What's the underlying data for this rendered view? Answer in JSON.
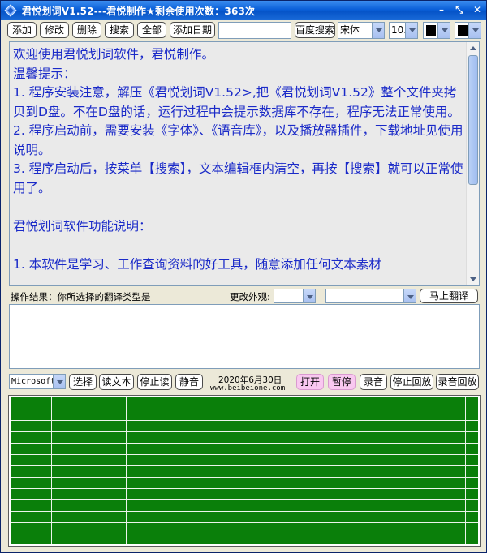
{
  "window": {
    "title": "君悦划词V1.52---君悦制作★剩余使用次数：363次"
  },
  "toolbar": {
    "add": "添加",
    "edit": "修改",
    "delete": "删除",
    "search": "搜索",
    "all": "全部",
    "add_date": "添加日期",
    "search_input_value": "",
    "baidu_search": "百度搜索",
    "font_value": "宋体",
    "font_size_value": "10.",
    "text_color": "#000000",
    "bg_color": "#000000"
  },
  "main_text": {
    "lines": [
      "欢迎使用君悦划词软件，君悦制作。",
      "温馨提示：",
      "1. 程序安装注意，解压《君悦划词V1.52>,把《君悦划词V1.52》整个文件夹拷贝到D盘。不在D盘的话，运行过程中会提示数据库不存在，程序无法正常使用。",
      "2. 程序启动前，需要安装《字体》、《语音库》，以及播放器插件，下载地址见使用说明。",
      "3. 程序启动后，按菜单【搜索】，文本编辑框内清空，再按【搜索】就可以正常使用了。",
      "",
      "君悦划词软件功能说明：",
      "",
      "1. 本软件是学习、工作查询资料的好工具，随意添加任何文本素材"
    ]
  },
  "status": {
    "result_label": "操作结果：你所选择的翻译类型是",
    "appearance_label": "更改外观:",
    "appearance_value": "",
    "translate_type_value": "",
    "translate_now": "马上翻译"
  },
  "result_box": {
    "text": ""
  },
  "lower": {
    "voice_value": "Microsoft",
    "select": "选择",
    "read_text": "读文本",
    "stop_read": "停止读",
    "mute": "静音",
    "date": "2020年6月30日",
    "website": "www.beibeione.com",
    "open": "打开",
    "pause": "暂停",
    "record": "录音",
    "stop_playback": "停止回放",
    "record_playback": "录音回放"
  },
  "grid": {
    "background": "#0a7f0a",
    "rows": 12,
    "columns": 4
  }
}
